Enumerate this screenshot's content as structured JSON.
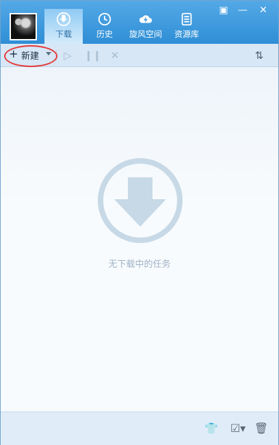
{
  "nav": {
    "download": "下载",
    "history": "历史",
    "cloud": "旋风空间",
    "library": "资源库"
  },
  "toolbar": {
    "new_label": "新建"
  },
  "main": {
    "empty_text": "无下载中的任务"
  },
  "colors": {
    "header": "#3d98db",
    "toolbar": "#d7e7f5",
    "empty_icon": "#c7d9e6",
    "highlight": "#e33a3a"
  }
}
